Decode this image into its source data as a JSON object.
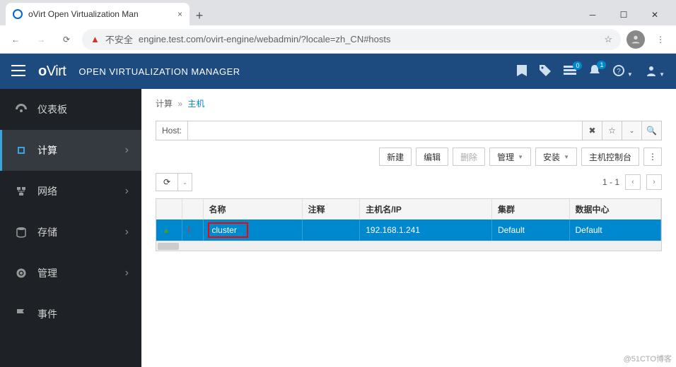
{
  "browser": {
    "tab_title": "oVirt Open Virtualization Man",
    "insecure_label": "不安全",
    "url": "engine.test.com/ovirt-engine/webadmin/?locale=zh_CN#hosts"
  },
  "header": {
    "logo_o": "o",
    "logo_rest": "Virt",
    "app_title": "OPEN VIRTUALIZATION MANAGER",
    "badge_tasks": "0",
    "badge_alerts": "1"
  },
  "sidebar": {
    "items": [
      {
        "label": "仪表板",
        "icon": "dashboard"
      },
      {
        "label": "计算",
        "icon": "compute",
        "active": true
      },
      {
        "label": "网络",
        "icon": "network"
      },
      {
        "label": "存储",
        "icon": "storage"
      },
      {
        "label": "管理",
        "icon": "admin"
      },
      {
        "label": "事件",
        "icon": "events"
      }
    ]
  },
  "breadcrumb": {
    "root": "计算",
    "current": "主机"
  },
  "search": {
    "label": "Host:",
    "value": ""
  },
  "toolbar": {
    "new_btn": "新建",
    "edit_btn": "编辑",
    "delete_btn": "删除",
    "manage_btn": "管理",
    "install_btn": "安装",
    "console_btn": "主机控制台"
  },
  "pager": {
    "text": "1 - 1"
  },
  "table": {
    "headers": {
      "name": "名称",
      "comment": "注释",
      "hostname": "主机名/IP",
      "cluster": "集群",
      "datacenter": "数据中心"
    },
    "row": {
      "name": "cluster",
      "comment": "",
      "hostname": "192.168.1.241",
      "cluster": "Default",
      "datacenter": "Default"
    }
  },
  "watermark": "@51CTO博客"
}
